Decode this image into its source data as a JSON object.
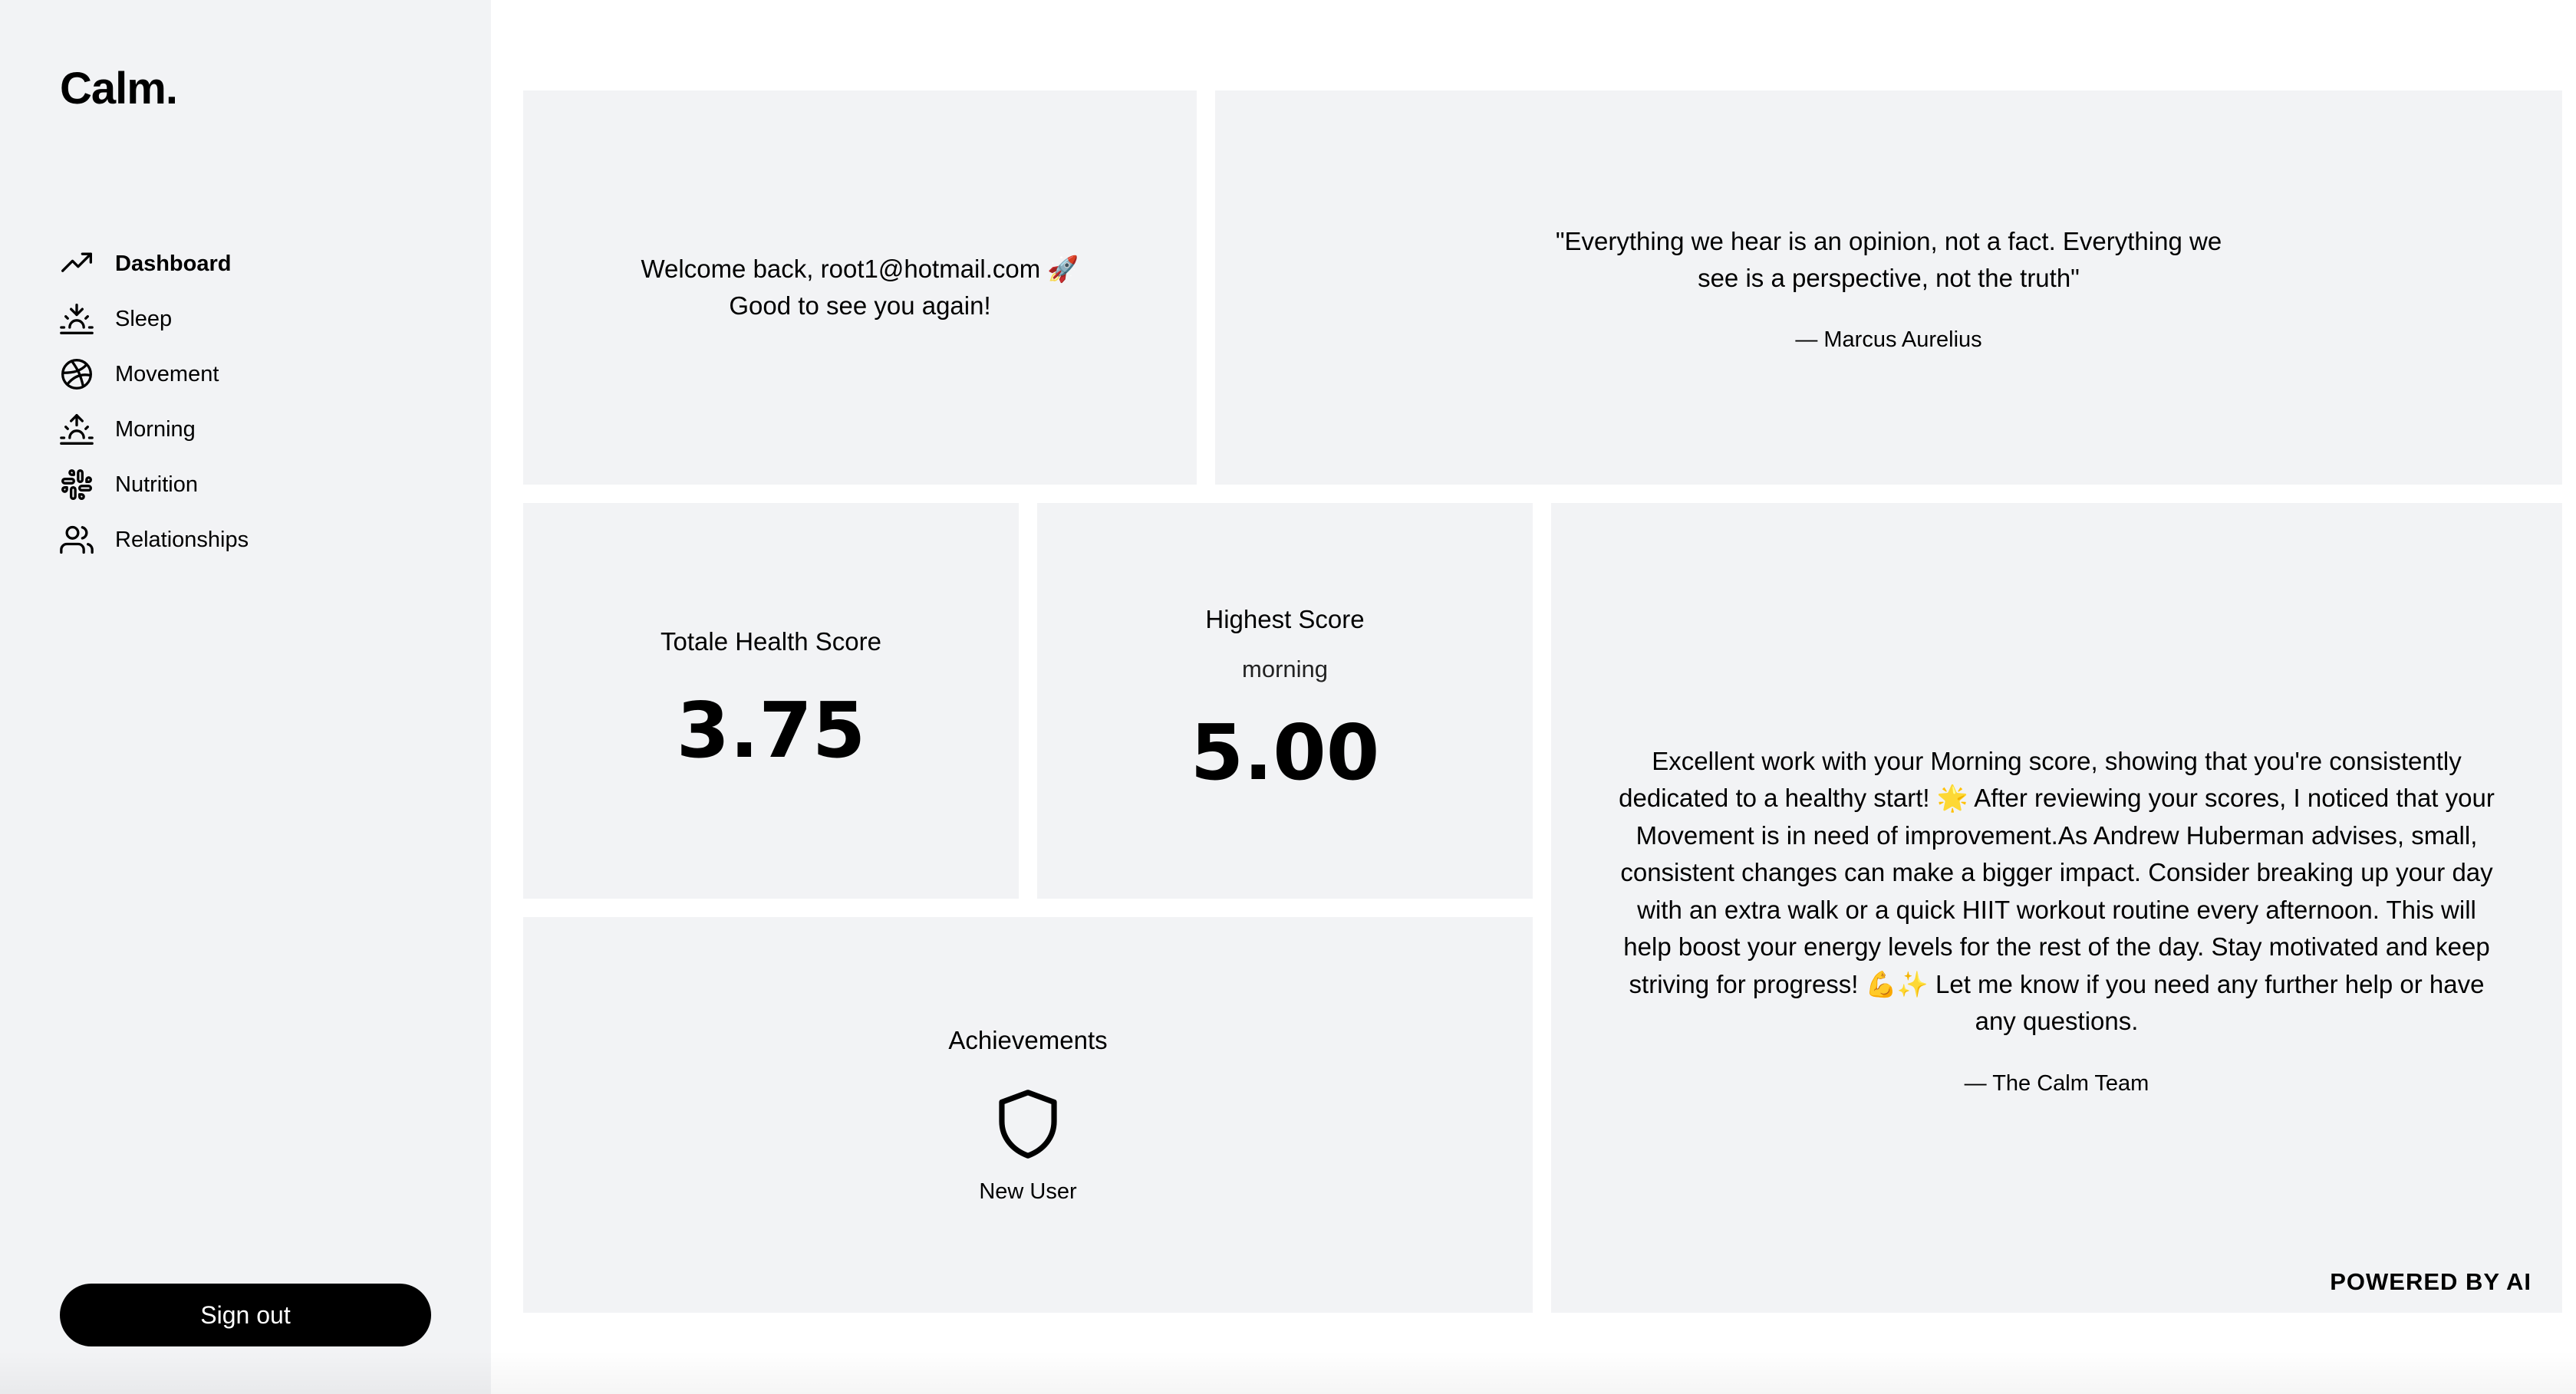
{
  "app": {
    "logo": "Calm."
  },
  "sidebar": {
    "items": [
      {
        "label": "Dashboard",
        "icon": "trending-up-icon",
        "active": true
      },
      {
        "label": "Sleep",
        "icon": "sunset-icon",
        "active": false
      },
      {
        "label": "Movement",
        "icon": "basketball-icon",
        "active": false
      },
      {
        "label": "Morning",
        "icon": "sunrise-icon",
        "active": false
      },
      {
        "label": "Nutrition",
        "icon": "slack-icon",
        "active": false
      },
      {
        "label": "Relationships",
        "icon": "users-icon",
        "active": false
      }
    ],
    "signout_label": "Sign out"
  },
  "welcome": {
    "line1": "Welcome back, root1@hotmail.com 🚀",
    "line2": "Good to see you again!"
  },
  "quote": {
    "text": "\"Everything we hear is an opinion, not a fact. Everything we see is a perspective, not the truth\"",
    "author": "— Marcus Aurelius"
  },
  "total_score": {
    "title": "Totale Health Score",
    "value": "3.75"
  },
  "highest_score": {
    "title": "Highest Score",
    "category": "morning",
    "value": "5.00"
  },
  "achievements": {
    "title": "Achievements",
    "badge_icon": "shield-icon",
    "badge_label": "New User"
  },
  "ai_feedback": {
    "text": "Excellent work with your Morning score, showing that you're consistently dedicated to a healthy start! 🌟 After reviewing your scores, I noticed that your Movement is in need of improvement.As Andrew Huberman advises, small, consistent changes can make a bigger impact. Consider breaking up your day with an extra walk or a quick HIIT workout routine every afternoon. This will help boost your energy levels for the rest of the day. Stay motivated and keep striving for progress! 💪✨ Let me know if you need any further help or have any questions.",
    "author": "— The Calm Team",
    "powered_by": "POWERED BY AI"
  },
  "colors": {
    "card_bg": "#f2f3f5",
    "sidebar_bg": "#f2f3f5",
    "button_bg": "#000000",
    "button_text": "#ffffff"
  }
}
